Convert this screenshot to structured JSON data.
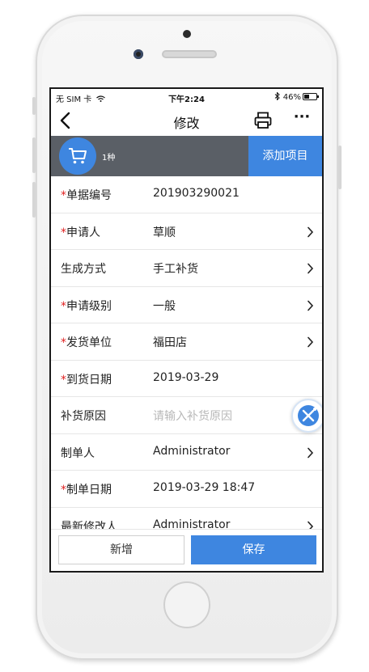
{
  "status_bar": {
    "carrier": "无 SIM 卡",
    "time": "下午2:24",
    "battery": "46%",
    "battery_level": 0.46
  },
  "nav": {
    "title": "修改"
  },
  "cart": {
    "count_label": "1种",
    "add_button": "添加项目"
  },
  "form": {
    "rows": [
      {
        "label": "单据编号",
        "required": true,
        "value": "201903290021",
        "placeholder": "",
        "chevron": false
      },
      {
        "label": "申请人",
        "required": true,
        "value": "草顺",
        "placeholder": "",
        "chevron": true
      },
      {
        "label": "生成方式",
        "required": false,
        "value": "手工补货",
        "placeholder": "",
        "chevron": true
      },
      {
        "label": "申请级别",
        "required": true,
        "value": "一般",
        "placeholder": "",
        "chevron": true
      },
      {
        "label": "发货单位",
        "required": true,
        "value": "福田店",
        "placeholder": "",
        "chevron": true
      },
      {
        "label": "到货日期",
        "required": true,
        "value": "2019-03-29",
        "placeholder": "",
        "chevron": false
      },
      {
        "label": "补货原因",
        "required": false,
        "value": "",
        "placeholder": "请输入补货原因",
        "chevron": false
      },
      {
        "label": "制单人",
        "required": false,
        "value": "Administrator",
        "placeholder": "",
        "chevron": true
      },
      {
        "label": "制单日期",
        "required": true,
        "value": "2019-03-29 18:47",
        "placeholder": "",
        "chevron": false
      },
      {
        "label": "最新修改人",
        "required": false,
        "value": "Administrator",
        "placeholder": "",
        "chevron": true
      }
    ]
  },
  "footer": {
    "new_label": "新增",
    "save_label": "保存"
  },
  "colors": {
    "accent": "#3e86e0",
    "required": "#e02020",
    "cartbar": "#5a5f66"
  },
  "icons": [
    "back-arrow-icon",
    "printer-icon",
    "more-icon",
    "cart-icon",
    "chevron-right-icon",
    "wifi-icon",
    "bluetooth-icon",
    "battery-icon",
    "assistant-float-icon"
  ]
}
